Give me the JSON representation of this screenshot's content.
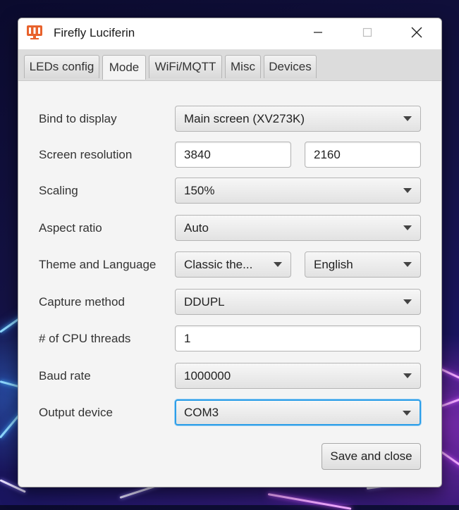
{
  "window": {
    "title": "Firefly Luciferin"
  },
  "tabs": [
    {
      "label": "LEDs config"
    },
    {
      "label": "Mode"
    },
    {
      "label": "WiFi/MQTT"
    },
    {
      "label": "Misc"
    },
    {
      "label": "Devices"
    }
  ],
  "active_tab": "Mode",
  "form": {
    "bind_display": {
      "label": "Bind to display",
      "value": "Main screen (XV273K)"
    },
    "resolution": {
      "label": "Screen resolution",
      "width": "3840",
      "height": "2160"
    },
    "scaling": {
      "label": "Scaling",
      "value": "150%"
    },
    "aspect_ratio": {
      "label": "Aspect ratio",
      "value": "Auto"
    },
    "theme_language": {
      "label": "Theme and Language",
      "theme": "Classic the...",
      "language": "English"
    },
    "capture_method": {
      "label": "Capture method",
      "value": "DDUPL"
    },
    "cpu_threads": {
      "label": "# of CPU threads",
      "value": "1"
    },
    "baud_rate": {
      "label": "Baud rate",
      "value": "1000000"
    },
    "output_device": {
      "label": "Output device",
      "value": "COM3"
    }
  },
  "buttons": {
    "save_close": "Save and close"
  },
  "colors": {
    "accent_focus": "#2c9ee8",
    "app_icon": "#e8622c"
  },
  "icons": [
    "app-icon",
    "minimize-icon",
    "maximize-icon",
    "close-icon",
    "chevron-down-icon"
  ]
}
